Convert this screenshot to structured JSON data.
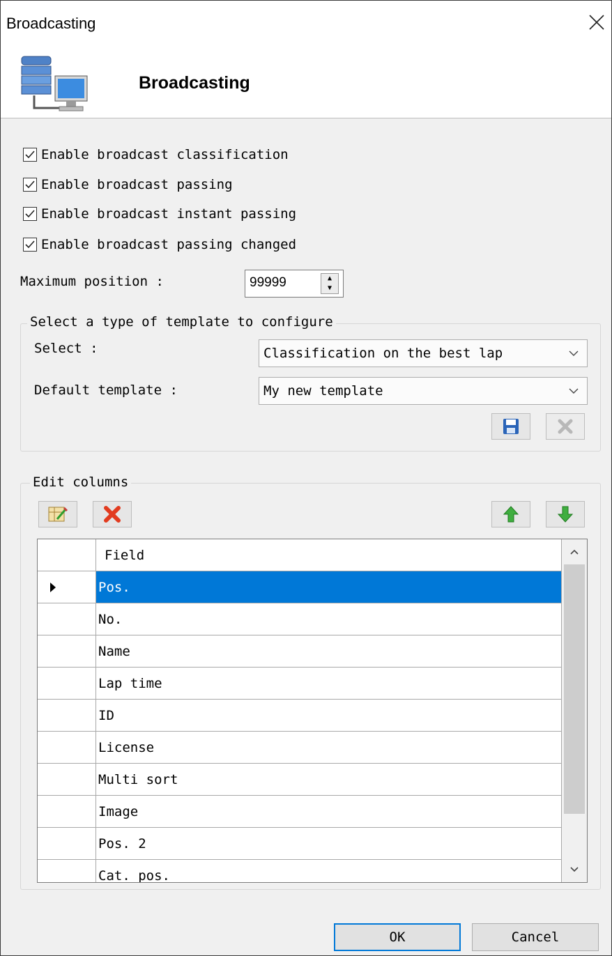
{
  "window": {
    "title": "Broadcasting"
  },
  "header": {
    "title": "Broadcasting",
    "icon": "server-computer-icon"
  },
  "options": [
    {
      "label": "Enable broadcast classification",
      "checked": true
    },
    {
      "label": "Enable broadcast passing",
      "checked": true
    },
    {
      "label": "Enable broadcast instant passing",
      "checked": true
    },
    {
      "label": "Enable broadcast passing changed",
      "checked": true
    }
  ],
  "max_position": {
    "label": "Maximum position :",
    "value": "99999"
  },
  "template_group": {
    "legend": "Select a type of template to configure",
    "select_label": "Select :",
    "select_value": "Classification on the best lap",
    "default_label": "Default template :",
    "default_value": "My new template",
    "save_icon": "floppy-disk-icon",
    "delete_icon": "gray-x-icon"
  },
  "columns_group": {
    "legend": "Edit columns",
    "grid_header": "Field",
    "selected_index": 0,
    "rows": [
      "Pos.",
      "No.",
      "Name",
      "Lap time",
      "ID",
      "License",
      "Multi sort",
      "Image",
      "Pos. 2",
      "Cat. pos."
    ]
  },
  "buttons": {
    "ok": "OK",
    "cancel": "Cancel"
  },
  "colors": {
    "selection": "#0078d7",
    "dialog_bg": "#f0f0f0",
    "header_bg": "#ffffff"
  }
}
